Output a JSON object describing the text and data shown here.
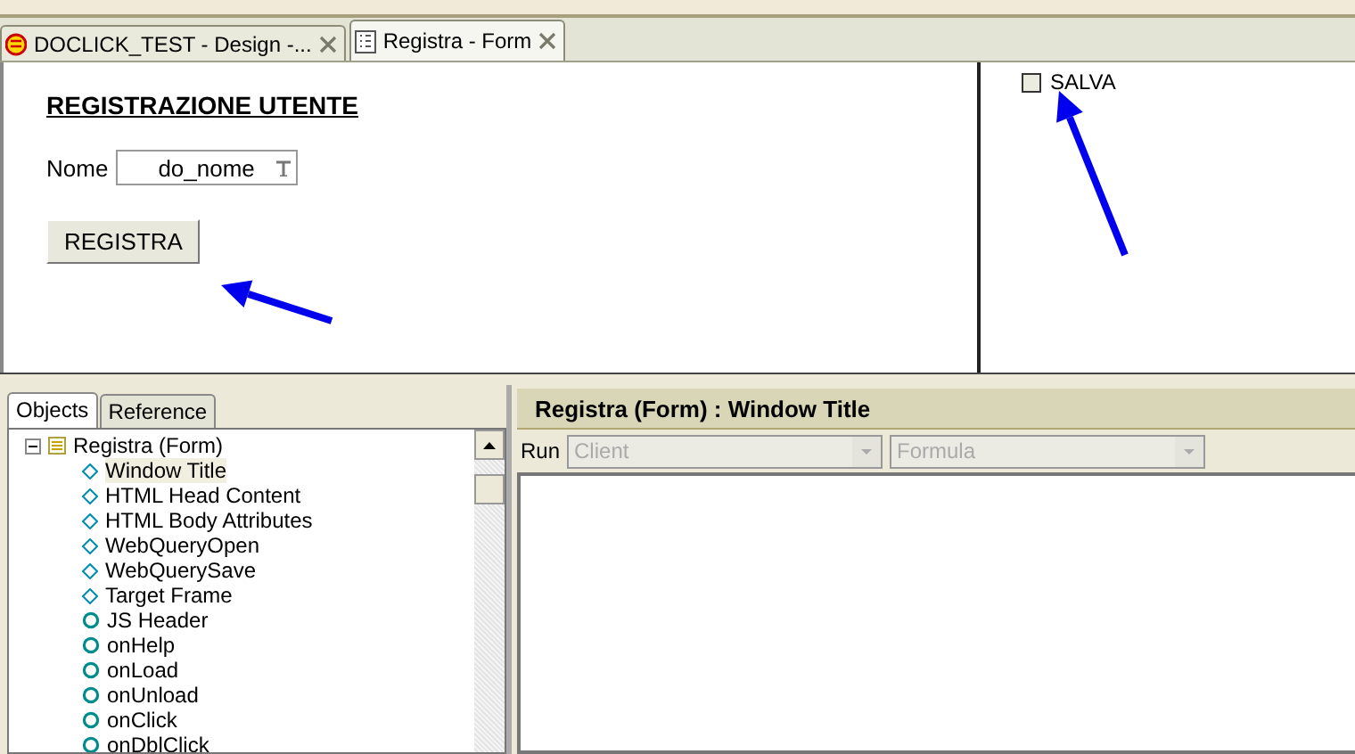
{
  "tabs": [
    {
      "label": "DOCLICK_TEST - Design -...",
      "selected": false,
      "kind": "database"
    },
    {
      "label": "Registra - Form",
      "selected": true,
      "kind": "form"
    }
  ],
  "form": {
    "heading": "REGISTRAZIONE UTENTE",
    "field_label": "Nome",
    "field_value": "do_nome",
    "button": "REGISTRA"
  },
  "action_pane": {
    "actions": [
      {
        "label": "SALVA"
      }
    ]
  },
  "objects_panel": {
    "tabs": [
      {
        "label": "Objects",
        "selected": true
      },
      {
        "label": "Reference",
        "selected": false
      }
    ],
    "tree": [
      {
        "label": "Registra (Form)",
        "expanded": true,
        "selected": false,
        "kind": "form",
        "children": [
          {
            "label": "Window Title",
            "kind": "diamond",
            "selected": true
          },
          {
            "label": "HTML Head Content",
            "kind": "diamond",
            "selected": false
          },
          {
            "label": "HTML Body Attributes",
            "kind": "diamond",
            "selected": false
          },
          {
            "label": "WebQueryOpen",
            "kind": "diamond",
            "selected": false
          },
          {
            "label": "WebQuerySave",
            "kind": "diamond",
            "selected": false
          },
          {
            "label": "Target Frame",
            "kind": "diamond",
            "selected": false
          },
          {
            "label": "JS Header",
            "kind": "circle",
            "selected": false
          },
          {
            "label": "onHelp",
            "kind": "circle",
            "selected": false
          },
          {
            "label": "onLoad",
            "kind": "circle",
            "selected": false
          },
          {
            "label": "onUnload",
            "kind": "circle",
            "selected": false
          },
          {
            "label": "onClick",
            "kind": "circle",
            "selected": false
          },
          {
            "label": "onDblClick",
            "kind": "circle",
            "selected": false
          }
        ]
      }
    ]
  },
  "programmer_pane": {
    "title": "Registra (Form) : Window Title",
    "run_label": "Run",
    "dropdowns": [
      {
        "value": "Client",
        "disabled": true
      },
      {
        "value": "Formula",
        "disabled": true
      }
    ]
  }
}
